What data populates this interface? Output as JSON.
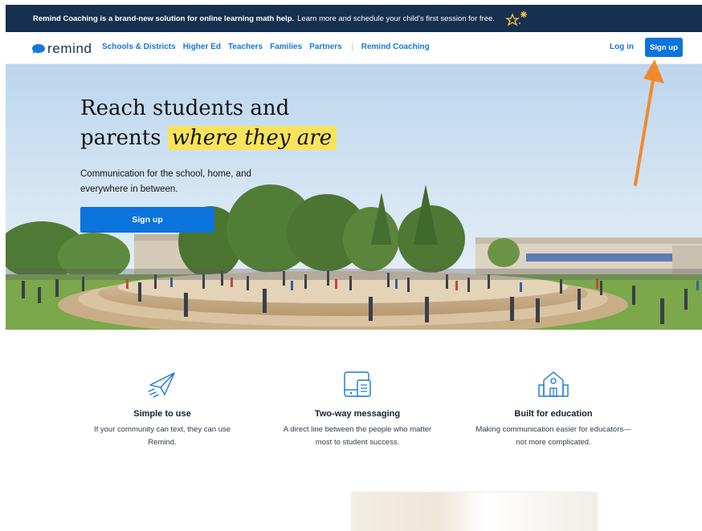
{
  "announcement": {
    "bold": "Remind Coaching is a brand-new solution for online learning math help.",
    "rest": "Learn more and schedule your child's first session for free."
  },
  "nav": {
    "logo": "remind",
    "links": [
      "Schools & Districts",
      "Higher Ed",
      "Teachers",
      "Families",
      "Partners"
    ],
    "coaching": "Remind Coaching",
    "login": "Log in",
    "signup": "Sign up"
  },
  "hero": {
    "title_line1": "Reach students and",
    "title_line2": "parents",
    "title_highlight": "where they are",
    "subtitle": "Communication for the school, home, and everywhere in between.",
    "signup": "Sign up"
  },
  "features": [
    {
      "icon": "paper-plane-icon",
      "title": "Simple to use",
      "desc": "If your community can text, they can use Remind."
    },
    {
      "icon": "messaging-device-icon",
      "title": "Two-way messaging",
      "desc": "A direct line between the people who matter most to student success."
    },
    {
      "icon": "school-building-icon",
      "title": "Built for education",
      "desc": "Making communication easier for educators—not more complicated."
    }
  ],
  "colors": {
    "announce_bg": "#17304f",
    "link_blue": "#1877d9",
    "button_blue": "#0b73dc",
    "highlight_yellow": "#f9e35a",
    "annotation_arrow": "#f28a2c"
  }
}
